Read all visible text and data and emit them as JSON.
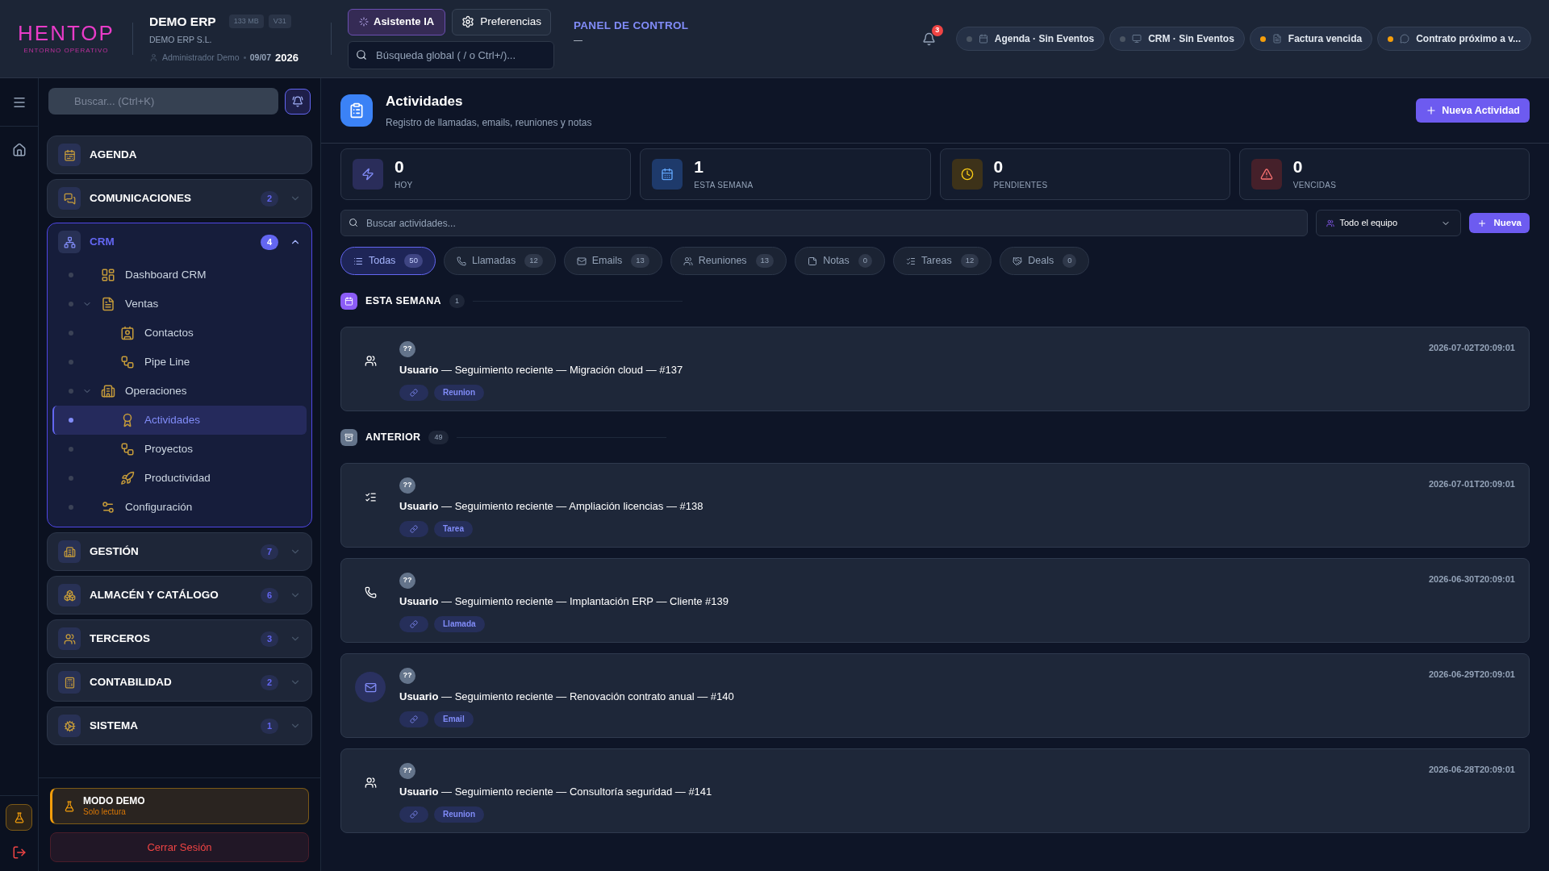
{
  "header": {
    "logo": {
      "text": "HENTOP",
      "tagline": "ENTORNO OPERATIVO"
    },
    "app": {
      "name": "DEMO ERP",
      "badges": [
        "133 MB",
        "V31"
      ],
      "company": "DEMO ERP S.L.",
      "user": "Administrador Demo",
      "date": "09/07",
      "year": "2026"
    },
    "assistant_button": "Asistente IA",
    "preferences_button": "Preferencias",
    "global_search": {
      "placeholder": "Búsqueda global ( / o Ctrl+/)..."
    },
    "panel": {
      "title": "PANEL DE CONTROL",
      "subtitle": "—"
    },
    "notifications": {
      "count": "3"
    },
    "chips": [
      {
        "kind": "calendar",
        "label": "Agenda · Sin Eventos",
        "color": "#4b5563"
      },
      {
        "kind": "monitor",
        "label": "CRM · Sin Eventos",
        "color": "#4b5563"
      },
      {
        "kind": "invoice",
        "label": "Factura vencida",
        "color": "#f59e0b"
      },
      {
        "kind": "message",
        "label": "Contrato próximo a v...",
        "color": "#f59e0b"
      }
    ]
  },
  "sidebar": {
    "search": {
      "placeholder": "Buscar... (Ctrl+K)"
    },
    "sections": [
      {
        "label": "AGENDA",
        "selected": false
      },
      {
        "label": "COMUNICACIONES",
        "badge": "2",
        "expanded": false,
        "selected": false
      },
      {
        "label": "CRM",
        "badge": "4",
        "expanded": true,
        "selected": true,
        "children": [
          {
            "kind": "dashboard",
            "label": "Dashboard CRM",
            "selected": false
          },
          {
            "kind": "sales",
            "label": "Ventas",
            "expanded": true,
            "selected": false,
            "children": [
              {
                "kind": "contacts",
                "label": "Contactos",
                "selected": false
              },
              {
                "kind": "pipeline",
                "label": "Pipe Line",
                "selected": false
              }
            ]
          },
          {
            "kind": "operations",
            "label": "Operaciones",
            "expanded": true,
            "selected": false,
            "children": [
              {
                "kind": "activities",
                "label": "Actividades",
                "selected": true
              },
              {
                "kind": "projects",
                "label": "Proyectos",
                "selected": false
              },
              {
                "kind": "productivity",
                "label": "Productividad",
                "selected": false
              }
            ]
          },
          {
            "kind": "settings",
            "label": "Configuración",
            "selected": false
          }
        ]
      },
      {
        "label": "GESTIÓN",
        "badge": "7",
        "expanded": false,
        "selected": false
      },
      {
        "label": "ALMACÉN Y CATÁLOGO",
        "badge": "6",
        "expanded": false,
        "selected": false
      },
      {
        "label": "TERCEROS",
        "badge": "3",
        "expanded": false,
        "selected": false
      },
      {
        "label": "CONTABILIDAD",
        "badge": "2",
        "expanded": false,
        "selected": false
      },
      {
        "label": "SISTEMA",
        "badge": "1",
        "expanded": false,
        "selected": false
      }
    ],
    "demo": {
      "title": "MODO DEMO",
      "subtitle": "Solo lectura"
    },
    "logout": "Cerrar Sesión"
  },
  "main": {
    "title": "Actividades",
    "subtitle": "Registro de llamadas, emails, reuniones y notas",
    "new_button": "Nueva Actividad",
    "stats": [
      {
        "kind": "today",
        "value": "0",
        "label": "HOY"
      },
      {
        "kind": "week",
        "value": "1",
        "label": "ESTA SEMANA"
      },
      {
        "kind": "pending",
        "value": "0",
        "label": "PENDIENTES"
      },
      {
        "kind": "overdue",
        "value": "0",
        "label": "VENCIDAS"
      }
    ],
    "search": {
      "placeholder": "Buscar actividades..."
    },
    "team_select": "Todo el equipo",
    "add_button": "Nueva",
    "filters": [
      {
        "kind": "all",
        "label": "Todas",
        "count": "50",
        "selected": true
      },
      {
        "kind": "call",
        "label": "Llamadas",
        "count": "12",
        "selected": false
      },
      {
        "kind": "email",
        "label": "Emails",
        "count": "13",
        "selected": false
      },
      {
        "kind": "meeting",
        "label": "Reuniones",
        "count": "13",
        "selected": false
      },
      {
        "kind": "note",
        "label": "Notas",
        "count": "0",
        "selected": false
      },
      {
        "kind": "task",
        "label": "Tareas",
        "count": "12",
        "selected": false
      },
      {
        "kind": "deal",
        "label": "Deals",
        "count": "0",
        "selected": false
      }
    ],
    "groups": [
      {
        "kind": "week",
        "title": "ESTA SEMANA",
        "count": "1",
        "items": [
          {
            "kind": "meeting",
            "avatar": "??",
            "text": "**Usuario** — Seguimiento reciente — Migración cloud — #137",
            "date": "2026-07-02T20:09:01",
            "tag": "Reunion"
          }
        ]
      },
      {
        "kind": "previous",
        "title": "ANTERIOR",
        "count": "49",
        "items": [
          {
            "kind": "task",
            "avatar": "??",
            "text": "**Usuario** — Seguimiento reciente — Ampliación licencias — #138",
            "date": "2026-07-01T20:09:01",
            "tag": "Tarea"
          },
          {
            "kind": "call",
            "avatar": "??",
            "text": "**Usuario** — Seguimiento reciente — Implantación ERP — Cliente #139",
            "date": "2026-06-30T20:09:01",
            "tag": "Llamada"
          },
          {
            "kind": "email",
            "avatar": "??",
            "text": "**Usuario** — Seguimiento reciente — Renovación contrato anual — #140",
            "date": "2026-06-29T20:09:01",
            "tag": "Email"
          },
          {
            "kind": "meeting",
            "avatar": "??",
            "text": "**Usuario** — Seguimiento reciente — Consultoría seguridad — #141",
            "date": "2026-06-28T20:09:01",
            "tag": "Reunion"
          }
        ]
      }
    ]
  }
}
